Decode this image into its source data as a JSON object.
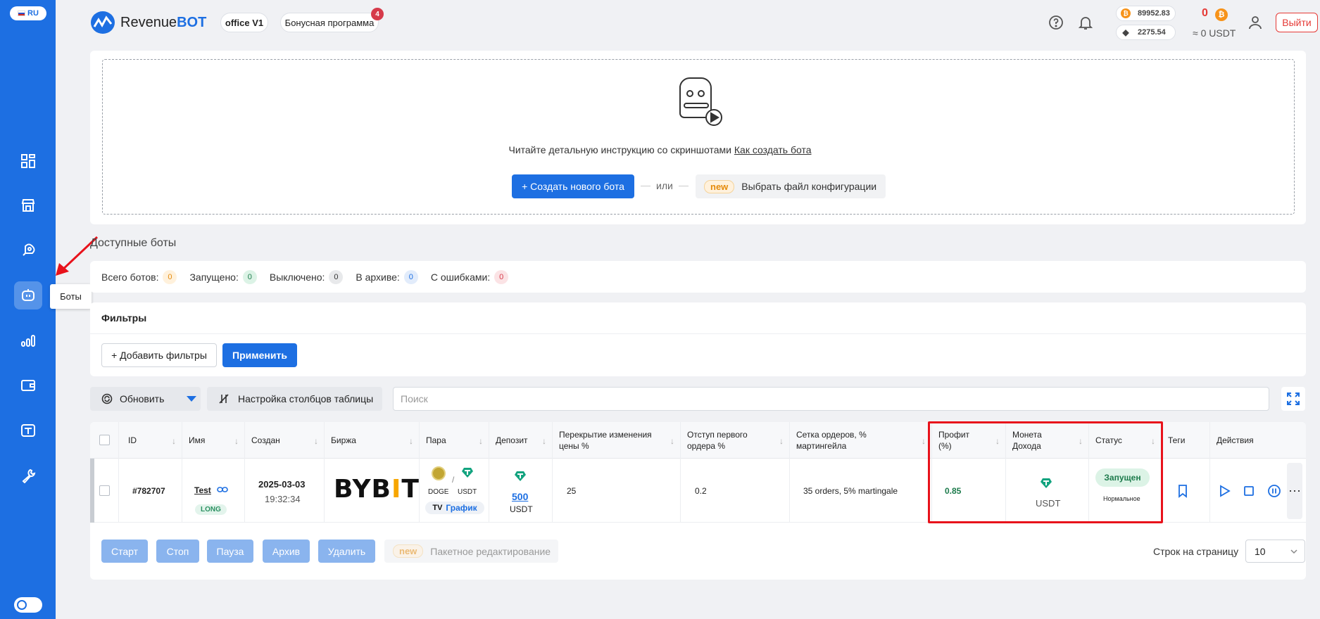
{
  "lang": "RU",
  "brand": {
    "name_regular": "Revenue",
    "name_bold": "BOT"
  },
  "header": {
    "office_label": "office V1",
    "bonus_label": "Бонусная программа",
    "bonus_count": "4",
    "btc_price": "89952.83",
    "eth_price": "2275.54",
    "balance_count": "0",
    "balance_usdt": "≈ 0 USDT",
    "exit_label": "Выйти",
    "btc_glyph": "₿"
  },
  "sidebar": {
    "tooltip": "Боты"
  },
  "instruction": {
    "text": "Читайте детальную инструкцию со скриншотами ",
    "link": "Как создать бота",
    "create_label": "+ Создать нового бота",
    "or_label": "или",
    "new_tag": "new",
    "config_label": "Выбрать файл конфигурации"
  },
  "bots": {
    "title": "Доступные боты",
    "stats": [
      {
        "label": "Всего ботов:",
        "count": "0",
        "bg": "#fff1dc",
        "color": "#e58b0b"
      },
      {
        "label": "Запущено:",
        "count": "0",
        "bg": "#dcf3e6",
        "color": "#1c7a4b"
      },
      {
        "label": "Выключено:",
        "count": "0",
        "bg": "#e8e9eb",
        "color": "#333333"
      },
      {
        "label": "В архиве:",
        "count": "0",
        "bg": "#e2ecfb",
        "color": "#1d6fe2"
      },
      {
        "label": "С ошибками:",
        "count": "0",
        "bg": "#fbe3e5",
        "color": "#d63a4a"
      }
    ]
  },
  "filters": {
    "title": "Фильтры",
    "add_label": "+ Добавить фильтры",
    "apply_label": "Применить"
  },
  "toolbar": {
    "refresh_label": "Обновить",
    "columns_label": "Настройка столбцов таблицы",
    "search_placeholder": "Поиск"
  },
  "table": {
    "headers": {
      "id": "ID",
      "name": "Имя",
      "created": "Создан",
      "exchange": "Биржа",
      "pair": "Пара",
      "deposit": "Депозит",
      "overlap": "Перекрытие изменения цены %",
      "offset": "Отступ первого ордера %",
      "grid": "Сетка ордеров, % мартингейла",
      "profit": "Профит (%)",
      "coin": "Монета Дохода",
      "status": "Статус",
      "tags": "Теги",
      "actions": "Действия"
    },
    "row": {
      "id": "#782707",
      "name": "Test",
      "side": "LONG",
      "date": "2025-03-03",
      "time": "19:32:34",
      "exchange_left": "BYB",
      "exchange_bar": "I",
      "exchange_right": "T",
      "pair_base": "DOGE",
      "pair_sep": "/",
      "pair_quote": "USDT",
      "chart_label": "График",
      "deposit_value": "500",
      "deposit_unit": "USDT",
      "overlap": "25",
      "offset": "0.2",
      "grid": "35 orders, 5% martingale",
      "profit": "0.85",
      "coin": "USDT",
      "status": "Запущен",
      "status_sub": "Нормальное"
    }
  },
  "bulk": {
    "start": "Старт",
    "stop": "Стоп",
    "pause": "Пауза",
    "archive": "Архив",
    "delete": "Удалить",
    "new_tag": "new",
    "edit_label": "Пакетное редактирование"
  },
  "pagination": {
    "rows_label": "Строк на страницу",
    "rows_value": "10"
  }
}
